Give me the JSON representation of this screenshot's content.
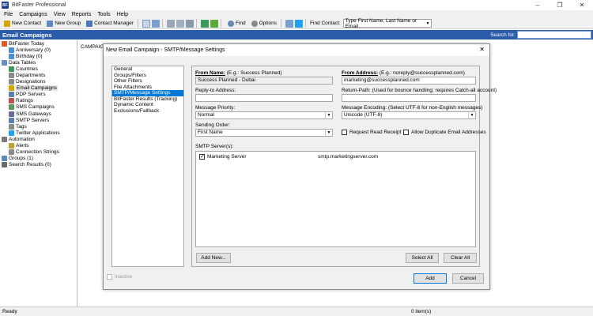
{
  "app": {
    "title": "BitFaster Professional",
    "icon_letter": "BF"
  },
  "window_controls": [
    "–",
    "❐",
    "✕"
  ],
  "menu": [
    "File",
    "Campaigns",
    "View",
    "Reports",
    "Tools",
    "Help"
  ],
  "toolbar": {
    "new_contact": "New Contact",
    "new_group": "New Group",
    "contact_manager": "Contact Manager",
    "find": "Find",
    "options": "Options",
    "find_contact_label": "Find Contact:",
    "find_contact_value": "Type First Name, Last Name or Email"
  },
  "header": {
    "title": "Email Campaigns",
    "search_label": "Search for:"
  },
  "tree": [
    {
      "label": "BitFaster Today",
      "indent": 0,
      "color": "#e05a2a"
    },
    {
      "label": "Anniversary (0)",
      "indent": 1,
      "color": "#4a90d9"
    },
    {
      "label": "Birthday (0)",
      "indent": 1,
      "color": "#4a90d9"
    },
    {
      "label": "Data Tables",
      "indent": 0,
      "color": "#6a8fc7"
    },
    {
      "label": "Countries",
      "indent": 1,
      "color": "#3a9a5a"
    },
    {
      "label": "Departments",
      "indent": 1,
      "color": "#8a8a8a"
    },
    {
      "label": "Designations",
      "indent": 1,
      "color": "#8a8a8a"
    },
    {
      "label": "Email Campaigns",
      "indent": 1,
      "color": "#d9a400"
    },
    {
      "label": "PDP Servers",
      "indent": 1,
      "color": "#5a7fb0"
    },
    {
      "label": "Ratings",
      "indent": 1,
      "color": "#c05050"
    },
    {
      "label": "SMS Campaigns",
      "indent": 1,
      "color": "#5a9a5a"
    },
    {
      "label": "SMS Gateways",
      "indent": 1,
      "color": "#6a6a9a"
    },
    {
      "label": "SMTP Servers",
      "indent": 1,
      "color": "#5a7fb0"
    },
    {
      "label": "Tags",
      "indent": 1,
      "color": "#8a8a8a"
    },
    {
      "label": "Twitter Applications",
      "indent": 1,
      "color": "#1da1f2"
    },
    {
      "label": "Automation",
      "indent": 0,
      "color": "#7a7a7a"
    },
    {
      "label": "Alerts",
      "indent": 1,
      "color": "#c0a030"
    },
    {
      "label": "Connection Strings",
      "indent": 1,
      "color": "#8a8a8a"
    },
    {
      "label": "Groups (1)",
      "indent": 0,
      "color": "#5a8ac0"
    },
    {
      "label": "Search Results (0)",
      "indent": 0,
      "color": "#6a6a6a"
    }
  ],
  "main": {
    "tab_label": "CAMPAIG"
  },
  "status": {
    "left": "Ready",
    "right": "0 item(s)"
  },
  "dialog": {
    "title": "New Email Campaign - SMTP/Message Settings",
    "nav_items": [
      "General",
      "Groups/Filters",
      "Other Filters",
      "File Attachments",
      "SMTP/Message Settings",
      "BitFaster Results (Tracking)",
      "Dynamic Content",
      "Exclusions/Fallback"
    ],
    "selected_nav": 4,
    "from_name_label": "From Name:",
    "from_name_hint": "(E.g.: Success Planned)",
    "from_name_value": "Success Planned - Dubai",
    "from_address_label": "From Address:",
    "from_address_hint": "(E.g.: noreply@successplanned.com)",
    "from_address_value": "marketing@successplanned.com",
    "reply_to_label": "Reply-to Address:",
    "reply_to_value": "",
    "return_path_label": "Return-Path:",
    "return_path_hint": "(Used for bounce handling; requires Catch-all account)",
    "return_path_value": "",
    "priority_label": "Message Priority:",
    "priority_value": "Normal",
    "encoding_label": "Message Encoding:",
    "encoding_hint": "(Select UTF-8 for non-English messages)",
    "encoding_value": "Unicode (UTF-8)",
    "sending_order_label": "Sending Order:",
    "sending_order_value": "First Name",
    "request_read_receipt": "Request Read Receipt",
    "allow_duplicates": "Allow Duplicate Email Addresses",
    "smtp_servers_label": "SMTP Server(s):",
    "smtp_servers": [
      {
        "name": "Marketing Server",
        "host": "smtp.marketingserver.com",
        "checked": true
      }
    ],
    "add_new": "Add New...",
    "select_all": "Select All",
    "clear_all": "Clear All",
    "inactive": "Inactive",
    "add": "Add",
    "cancel": "Cancel"
  }
}
